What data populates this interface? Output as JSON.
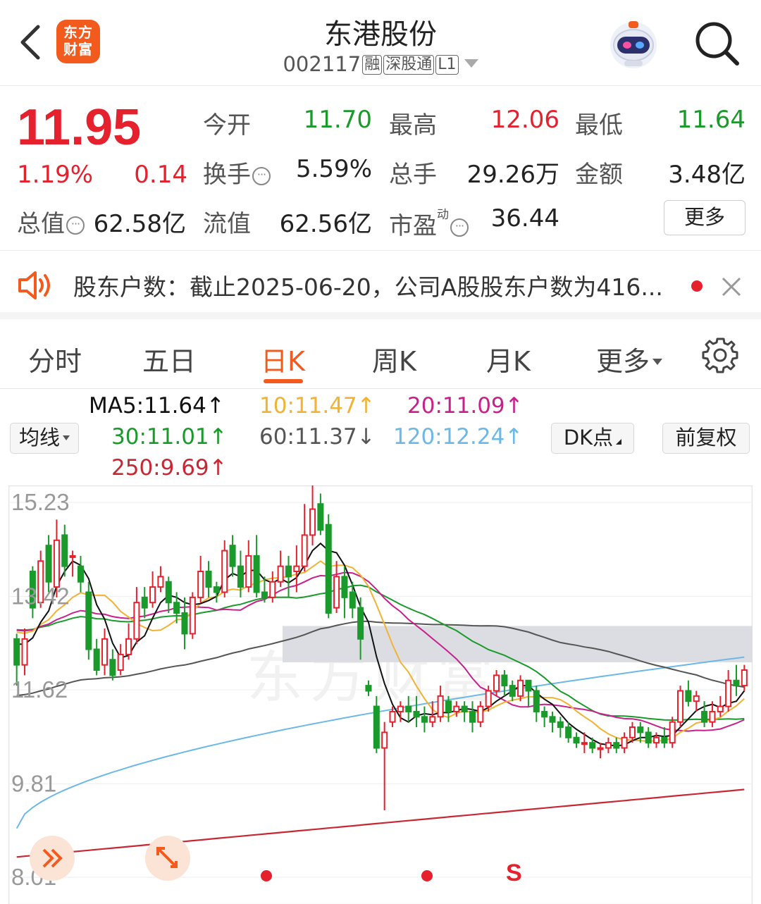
{
  "header": {
    "logo_text_line1": "东方",
    "logo_text_line2": "财富",
    "title": "东港股份",
    "code": "002117",
    "tags": [
      "融",
      "深股通",
      "L1"
    ]
  },
  "quote": {
    "price": "11.95",
    "change_pct": "1.19%",
    "change": "0.14",
    "open_label": "今开",
    "open": "11.70",
    "high_label": "最高",
    "high": "12.06",
    "low_label": "最低",
    "low": "11.64",
    "turnover_label": "换手",
    "turnover": "5.59%",
    "volume_label": "总手",
    "volume": "29.26万",
    "amount_label": "金额",
    "amount": "3.48亿",
    "mktcap_label": "总值",
    "mktcap": "62.58亿",
    "float_label": "流值",
    "float_cap": "62.56亿",
    "pe_label": "市盈",
    "pe_sup": "动",
    "pe": "36.44",
    "more_label": "更多"
  },
  "notice": {
    "text": "股东户数：截止2025-06-20，公司A股股东户数为416..."
  },
  "tabs": [
    "分时",
    "五日",
    "日K",
    "周K",
    "月K",
    "更多"
  ],
  "ma_panel": {
    "selector_label": "均线",
    "ma5": "MA5:11.64↑",
    "ma10": "10:11.47↑",
    "ma20": "20:11.09↑",
    "ma30": "30:11.01↑",
    "ma60": "60:11.37↓",
    "ma120": "120:12.24↑",
    "ma250": "250:9.69↑",
    "dk_label": "DK点",
    "adjust_label": "前复权"
  },
  "colors": {
    "up": "#e4212c",
    "down": "#1a9a2a",
    "ma5": "#111111",
    "ma10": "#f2b233",
    "ma20": "#c8208c",
    "ma30": "#1a9a2a",
    "ma60": "#555555",
    "ma120": "#6cb8e6",
    "ma250": "#c62834",
    "accent": "#f25a1e"
  },
  "chart_data": {
    "type": "candlestick",
    "y_labels": [
      "15.23",
      "13.42",
      "11.62",
      "9.81",
      "8.01"
    ],
    "ylim": [
      8.01,
      15.23
    ],
    "watermark": "东方财富",
    "signal_markers": [
      "•",
      "•",
      "S"
    ],
    "candles": [
      [
        12.6,
        12.1,
        12.7,
        11.7
      ],
      [
        12.1,
        12.6,
        12.8,
        11.9
      ],
      [
        13.9,
        13.2,
        14.0,
        13.0
      ],
      [
        13.3,
        14.1,
        14.3,
        13.2
      ],
      [
        14.4,
        13.7,
        14.6,
        13.5
      ],
      [
        13.6,
        14.5,
        14.9,
        13.4
      ],
      [
        14.6,
        14.0,
        14.8,
        13.8
      ],
      [
        14.2,
        14.2,
        14.3,
        13.8
      ],
      [
        14.0,
        13.7,
        14.2,
        13.5
      ],
      [
        13.5,
        12.4,
        13.7,
        12.2
      ],
      [
        12.4,
        12.0,
        12.6,
        11.9
      ],
      [
        12.1,
        12.6,
        12.8,
        11.9
      ],
      [
        12.2,
        11.9,
        12.4,
        11.8
      ],
      [
        12.0,
        12.3,
        12.5,
        11.9
      ],
      [
        12.3,
        12.6,
        12.9,
        12.2
      ],
      [
        12.6,
        13.3,
        13.6,
        12.5
      ],
      [
        13.4,
        13.2,
        13.6,
        13.0
      ],
      [
        13.3,
        13.6,
        13.9,
        13.2
      ],
      [
        13.6,
        13.8,
        14.0,
        13.5
      ],
      [
        13.7,
        13.3,
        13.8,
        13.1
      ],
      [
        13.3,
        13.1,
        13.5,
        12.9
      ],
      [
        13.1,
        12.7,
        13.4,
        12.4
      ],
      [
        12.7,
        13.4,
        13.5,
        12.6
      ],
      [
        13.4,
        13.9,
        14.2,
        13.3
      ],
      [
        13.9,
        13.6,
        14.1,
        13.4
      ],
      [
        13.6,
        13.5,
        13.7,
        13.3
      ],
      [
        13.5,
        14.3,
        14.5,
        13.4
      ],
      [
        14.4,
        14.0,
        14.6,
        13.8
      ],
      [
        14.0,
        13.6,
        14.3,
        13.4
      ],
      [
        13.6,
        14.2,
        14.5,
        13.5
      ],
      [
        14.2,
        13.5,
        14.6,
        13.4
      ],
      [
        13.5,
        13.4,
        13.8,
        13.3
      ],
      [
        13.4,
        13.7,
        13.9,
        13.3
      ],
      [
        13.7,
        14.0,
        14.3,
        13.6
      ],
      [
        14.0,
        13.8,
        14.2,
        13.4
      ],
      [
        13.9,
        14.0,
        14.4,
        13.5
      ],
      [
        14.0,
        14.6,
        15.2,
        13.9
      ],
      [
        14.6,
        15.1,
        15.6,
        14.4
      ],
      [
        15.2,
        14.7,
        15.4,
        14.6
      ],
      [
        14.8,
        13.1,
        15.0,
        13.0
      ],
      [
        13.2,
        13.8,
        14.1,
        13.1
      ],
      [
        13.8,
        13.4,
        14.0,
        13.0
      ],
      [
        13.5,
        13.2,
        13.7,
        13.0
      ],
      [
        13.2,
        12.6,
        13.4,
        12.2
      ],
      [
        11.7,
        11.6,
        11.8,
        11.5
      ],
      [
        11.3,
        10.5,
        11.5,
        10.4
      ],
      [
        10.5,
        10.8,
        11.0,
        9.3
      ],
      [
        11.0,
        11.2,
        11.3,
        10.9
      ],
      [
        11.2,
        11.3,
        11.4,
        11.0
      ],
      [
        11.3,
        11.2,
        11.5,
        11.0
      ],
      [
        11.2,
        11.1,
        11.5,
        10.9
      ],
      [
        11.1,
        11.0,
        11.3,
        10.8
      ],
      [
        11.0,
        11.1,
        11.4,
        10.9
      ],
      [
        11.1,
        11.5,
        11.7,
        11.0
      ],
      [
        11.4,
        11.2,
        11.5,
        11.0
      ],
      [
        11.2,
        11.3,
        11.4,
        11.1
      ],
      [
        11.3,
        11.2,
        11.4,
        11.0
      ],
      [
        11.2,
        11.0,
        11.4,
        10.8
      ],
      [
        11.0,
        11.3,
        11.4,
        10.9
      ],
      [
        11.3,
        11.6,
        11.7,
        11.2
      ],
      [
        11.6,
        11.9,
        12.0,
        11.5
      ],
      [
        11.9,
        11.7,
        12.0,
        11.5
      ],
      [
        11.7,
        11.5,
        11.8,
        11.4
      ],
      [
        11.5,
        11.8,
        11.9,
        11.4
      ],
      [
        11.8,
        11.6,
        11.8,
        11.3
      ],
      [
        11.6,
        11.2,
        11.7,
        11.0
      ],
      [
        11.2,
        11.1,
        11.3,
        10.9
      ],
      [
        11.1,
        11.0,
        11.2,
        10.8
      ],
      [
        11.0,
        10.9,
        11.1,
        10.7
      ],
      [
        10.9,
        10.7,
        11.0,
        10.6
      ],
      [
        10.7,
        10.6,
        10.8,
        10.5
      ],
      [
        10.6,
        10.6,
        10.8,
        10.4
      ],
      [
        10.6,
        10.5,
        10.7,
        10.4
      ],
      [
        10.5,
        10.5,
        10.6,
        10.3
      ],
      [
        10.5,
        10.6,
        10.7,
        10.4
      ],
      [
        10.6,
        10.5,
        10.7,
        10.4
      ],
      [
        10.5,
        10.7,
        10.8,
        10.4
      ],
      [
        10.7,
        10.9,
        11.0,
        10.6
      ],
      [
        10.9,
        10.8,
        11.0,
        10.6
      ],
      [
        10.8,
        10.6,
        10.9,
        10.5
      ],
      [
        10.6,
        10.7,
        10.8,
        10.5
      ],
      [
        10.7,
        10.6,
        10.9,
        10.5
      ],
      [
        10.6,
        11.0,
        11.1,
        10.5
      ],
      [
        11.0,
        11.6,
        11.7,
        10.9
      ],
      [
        11.6,
        11.4,
        11.8,
        11.3
      ],
      [
        11.4,
        11.5,
        11.6,
        11.2
      ],
      [
        11.2,
        11.0,
        11.4,
        10.9
      ],
      [
        11.0,
        11.2,
        11.4,
        10.9
      ],
      [
        11.2,
        11.3,
        11.5,
        11.1
      ],
      [
        11.3,
        11.8,
        12.0,
        11.2
      ],
      [
        11.8,
        11.7,
        12.1,
        11.5
      ],
      [
        11.7,
        12.0,
        12.1,
        11.6
      ]
    ]
  }
}
